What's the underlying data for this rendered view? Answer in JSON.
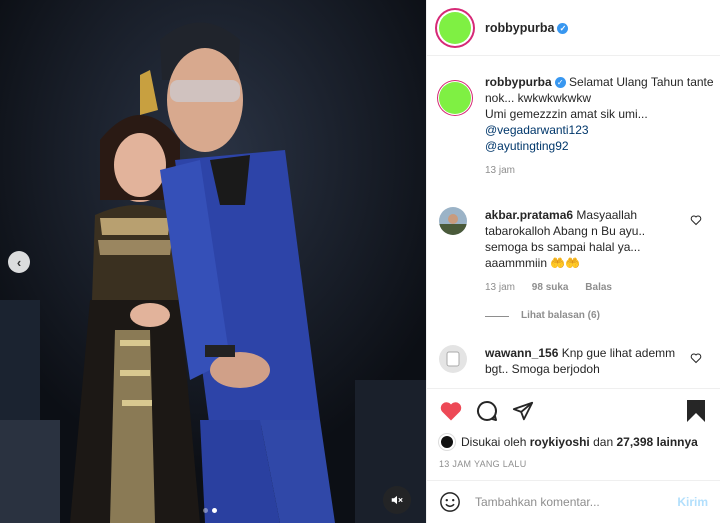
{
  "post": {
    "username": "robbypurba",
    "verified": true
  },
  "caption": {
    "username": "robbypurba",
    "text_line1": "Selamat Ulang Tahun tante nok... kwkwkwkwkw",
    "text_line2": "Umi gemezzzin amat sik umi...",
    "mentions": [
      "@vegadarwanti123",
      "@ayutingting92"
    ],
    "time": "13 jam"
  },
  "comments": [
    {
      "username": "akbar.pratama6",
      "text": "Masyaallah tabarokalloh Abang n Bu ayu.. semoga bs sampai halal ya... aaammmiin",
      "emoji": "🤲🤲",
      "time": "13 jam",
      "likes": "98 suka",
      "reply_label": "Balas",
      "view_replies": "Lihat balasan (6)"
    },
    {
      "username": "wawann_156",
      "text": "Knp gue lihat ademm bgt.. Smoga berjodoh"
    }
  ],
  "likes": {
    "prefix": "Disukai oleh",
    "user": "roykiyoshi",
    "middle": "dan",
    "count": "27,398 lainnya"
  },
  "time_ago": "13 JAM YANG LALU",
  "add_comment": {
    "placeholder": "Tambahkan komentar...",
    "post_label": "Kirim"
  },
  "icons": {
    "like": "heart-filled-icon",
    "comment": "comment-icon",
    "share": "send-icon",
    "save": "bookmark-filled-icon",
    "emoji": "smiley-icon",
    "mute": "speaker-muted-icon",
    "prev": "chevron-left-icon"
  },
  "colors": {
    "like_red": "#ed4956",
    "avatar_green": "#7ff043",
    "story_ring": "#d62976",
    "link": "#00376b",
    "verified_blue": "#3897f0"
  }
}
